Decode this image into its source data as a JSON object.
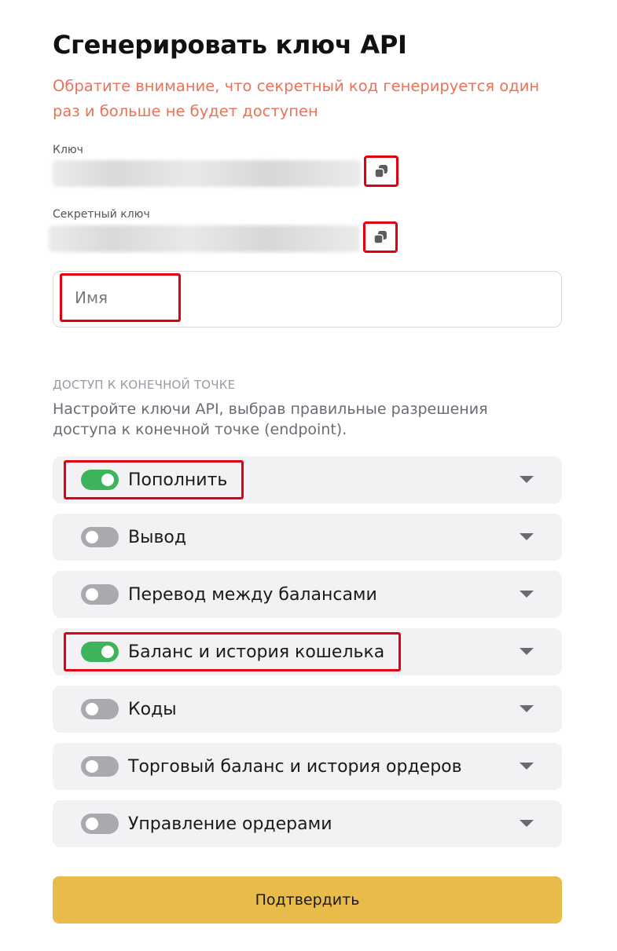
{
  "page": {
    "title": "Сгенерировать ключ API",
    "warning": "Обратите внимание, что секретный код генерируется один раз и больше не будет доступен"
  },
  "key_field": {
    "label": "Ключ",
    "copy_icon": "copy-icon"
  },
  "secret_field": {
    "label": "Секретный ключ",
    "copy_icon": "copy-icon"
  },
  "name_input": {
    "placeholder": "Имя",
    "value": ""
  },
  "endpoint_access": {
    "caption": "ДОСТУП К КОНЕЧНОЙ ТОЧКЕ",
    "description": "Настройте ключи API, выбрав правильные разрешения доступа к конечной точке (endpoint).",
    "items": [
      {
        "label": "Пополнить",
        "enabled": true
      },
      {
        "label": "Вывод",
        "enabled": false
      },
      {
        "label": "Перевод между балансами",
        "enabled": false
      },
      {
        "label": "Баланс и история кошелька",
        "enabled": true
      },
      {
        "label": "Коды",
        "enabled": false
      },
      {
        "label": "Торговый баланс и история ордеров",
        "enabled": false
      },
      {
        "label": "Управление ордерами",
        "enabled": false
      }
    ]
  },
  "confirm_button": {
    "label": "Подтвердить"
  },
  "colors": {
    "warning": "#e8735a",
    "toggle_on": "#3db35b",
    "toggle_off": "#a9a9ae",
    "highlight_box": "#e0000f",
    "confirm_bg": "#e9bb4a",
    "row_bg": "#f2f2f5"
  }
}
